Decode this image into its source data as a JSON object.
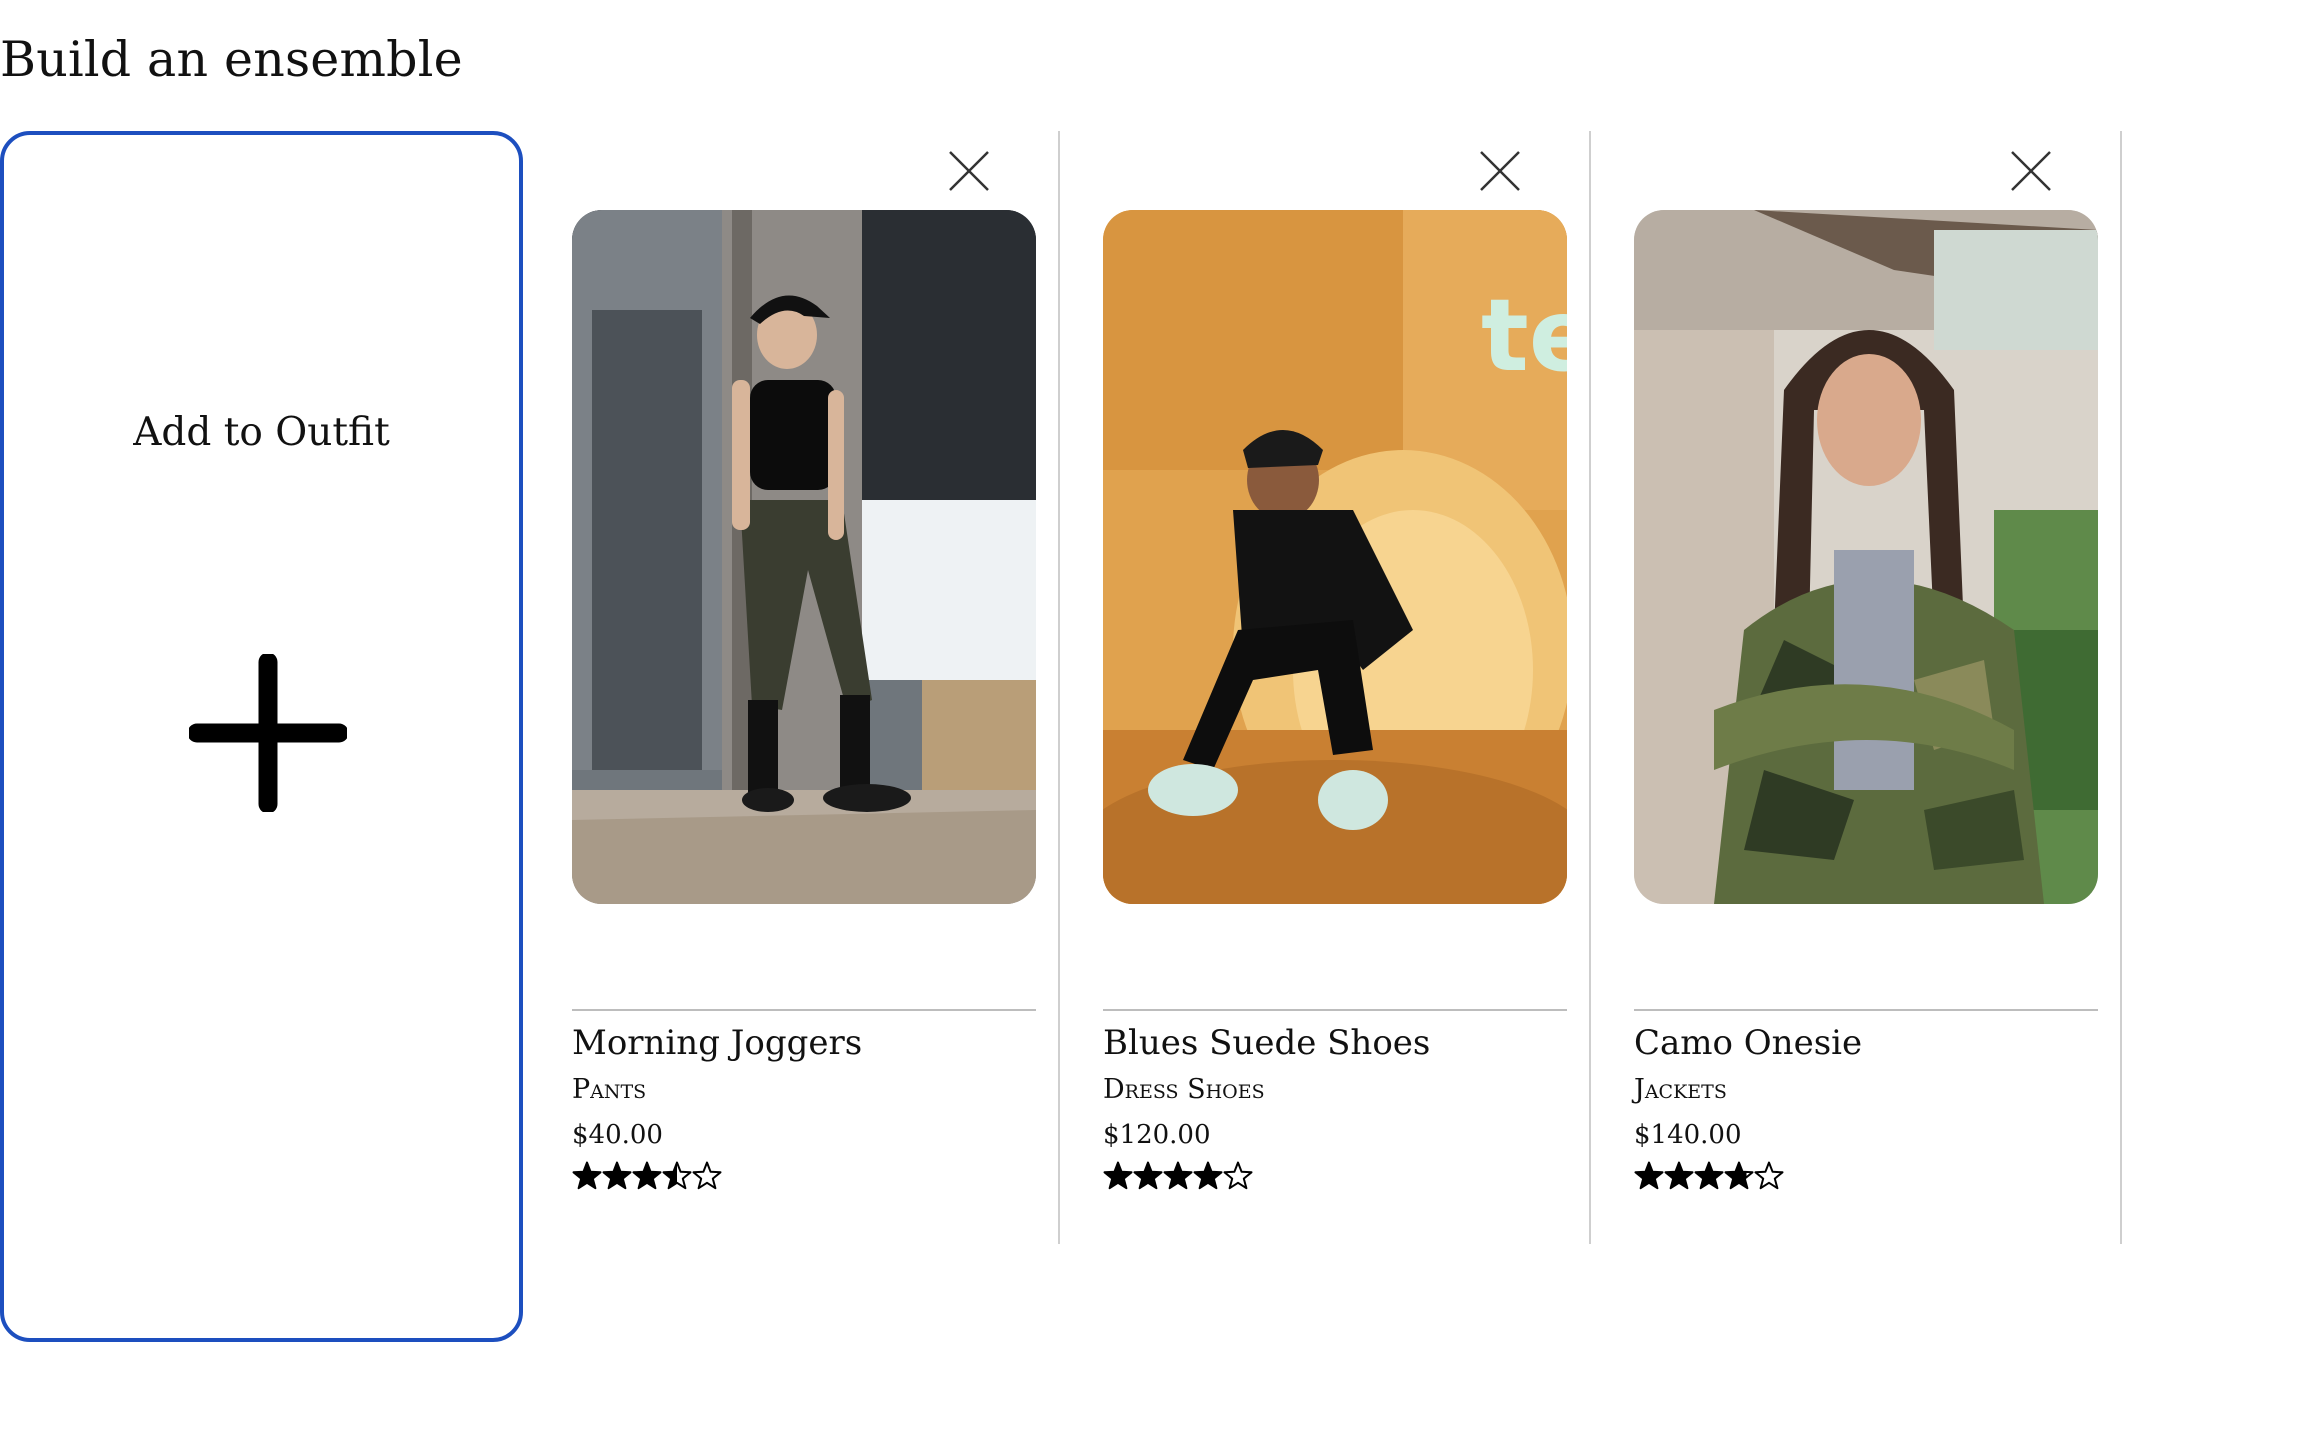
{
  "section": {
    "title": "Build an ensemble"
  },
  "add_card": {
    "label": "Add to Outfit",
    "icon": "plus-icon",
    "accent_color": "#1d4fbf"
  },
  "outfit_items": [
    {
      "name": "Morning Joggers",
      "category": "Pants",
      "price": "$40.00",
      "rating": 3.5,
      "rating_max": 5,
      "image": "woman-in-cap-and-joggers-photo",
      "remove_icon": "close-icon"
    },
    {
      "name": "Blues Suede Shoes",
      "category": "Dress Shoes",
      "price": "$120.00",
      "rating": 4,
      "rating_max": 5,
      "image": "man-on-fur-beanbag-photo",
      "remove_icon": "close-icon"
    },
    {
      "name": "Camo Onesie",
      "category": "Jackets",
      "price": "$140.00",
      "rating": 3.75,
      "rating_max": 5,
      "image": "woman-in-camo-jacket-photo",
      "remove_icon": "close-icon"
    }
  ]
}
